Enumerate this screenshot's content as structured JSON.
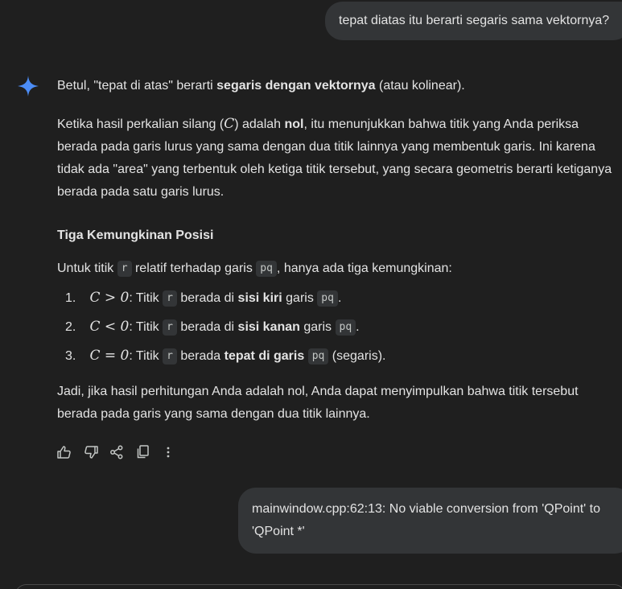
{
  "user_messages": {
    "first": "tepat diatas itu berarti segaris sama vektornya?",
    "second": "mainwindow.cpp:62:13: No viable conversion from 'QPoint' to 'QPoint *'"
  },
  "response": {
    "p1_a": "Betul, \"tepat di atas\" berarti ",
    "p1_b": "segaris dengan vektornya",
    "p1_c": " (atau kolinear).",
    "p2_a": "Ketika hasil perkalian silang (",
    "p2_math": "C",
    "p2_b": ") adalah ",
    "p2_bold": "nol",
    "p2_c": ", itu menunjukkan bahwa titik yang Anda periksa berada pada garis lurus yang sama dengan dua titik lainnya yang membentuk garis. Ini karena tidak ada \"area\" yang terbentuk oleh ketiga titik tersebut, yang secara geometris berarti ketiganya berada pada satu garis lurus.",
    "heading": "Tiga Kemungkinan Posisi",
    "p3_a": "Untuk titik ",
    "p3_code1": "r",
    "p3_b": " relatif terhadap garis ",
    "p3_code2": "pq",
    "p3_c": ", hanya ada tiga kemungkinan:",
    "list": [
      {
        "num": "1.",
        "math": "C > 0",
        "a": ": Titik ",
        "code": "r",
        "b": " berada di ",
        "bold": "sisi kiri",
        "c": " garis ",
        "code2": "pq",
        "d": "."
      },
      {
        "num": "2.",
        "math": "C < 0",
        "a": ": Titik ",
        "code": "r",
        "b": " berada di ",
        "bold": "sisi kanan",
        "c": " garis ",
        "code2": "pq",
        "d": "."
      },
      {
        "num": "3.",
        "math": "C = 0",
        "a": ": Titik ",
        "code": "r",
        "b": " berada ",
        "bold": "tepat di garis",
        "c": " ",
        "code2": "pq",
        "d": " (segaris)."
      }
    ],
    "p4": "Jadi, jika hasil perhitungan Anda adalah nol, Anda dapat menyimpulkan bahwa titik tersebut berada pada garis yang sama dengan dua titik lainnya."
  },
  "actions": [
    "thumb-up-icon",
    "thumb-down-icon",
    "share-icon",
    "copy-icon",
    "more-vert-icon"
  ],
  "colors": {
    "background": "#1f1f1f",
    "bubble": "#333537",
    "text": "#e3e3e3",
    "spark": "#4c8df6"
  }
}
